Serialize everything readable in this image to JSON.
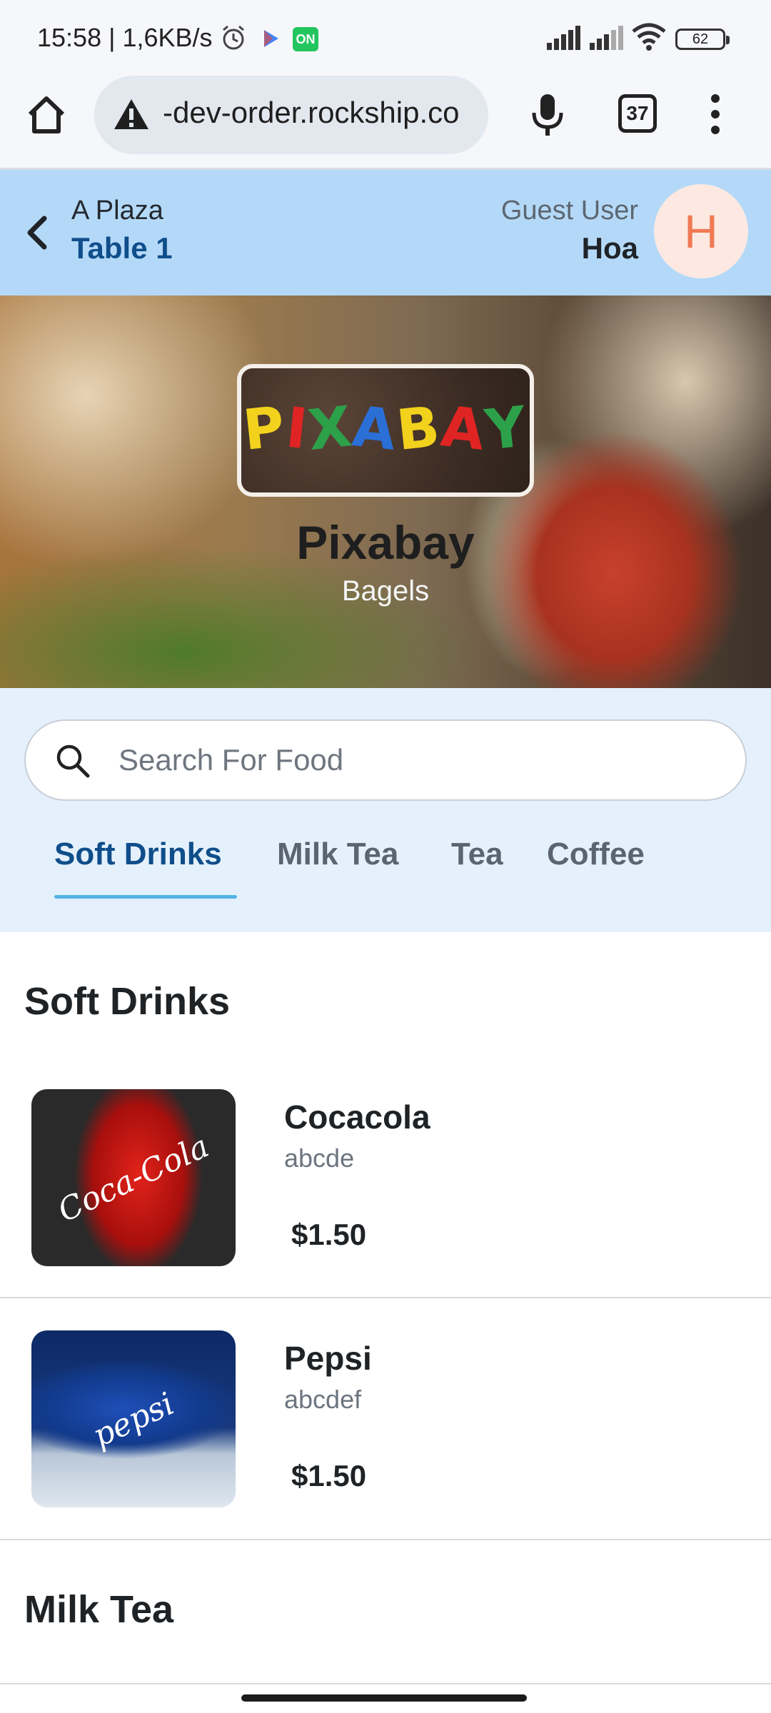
{
  "status_bar": {
    "time_speed": "15:58 | 1,6KB/s",
    "on_badge": "ON",
    "battery": "62"
  },
  "browser": {
    "url": "-dev-order.rockship.co",
    "tab_count": "37"
  },
  "header": {
    "venue": "A Plaza",
    "table": "Table 1",
    "guest_label": "Guest User",
    "guest_name": "Hoa",
    "avatar_initial": "H"
  },
  "hero": {
    "logo_letters": [
      {
        "char": "P",
        "color": "#f2d21c"
      },
      {
        "char": "I",
        "color": "#e02424"
      },
      {
        "char": "X",
        "color": "#2da04a"
      },
      {
        "char": "A",
        "color": "#2a6fd6"
      },
      {
        "char": "B",
        "color": "#f2d21c"
      },
      {
        "char": "A",
        "color": "#e02424"
      },
      {
        "char": "Y",
        "color": "#2da04a"
      }
    ],
    "title": "Pixabay",
    "subtitle": "Bagels"
  },
  "search": {
    "placeholder": "Search For Food",
    "value": ""
  },
  "tabs": [
    {
      "label": "Soft Drinks",
      "active": true
    },
    {
      "label": "Milk Tea",
      "active": false
    },
    {
      "label": "Tea",
      "active": false
    },
    {
      "label": "Coffee",
      "active": false
    }
  ],
  "sections": [
    {
      "title": "Soft Drinks",
      "items": [
        {
          "name": "Cocacola",
          "desc": "abcde",
          "price": "$1.50",
          "image_text": "Coca-Cola"
        },
        {
          "name": "Pepsi",
          "desc": "abcdef",
          "price": "$1.50",
          "image_text": "pepsi"
        }
      ]
    },
    {
      "title": "Milk Tea",
      "items": []
    }
  ],
  "icons": {
    "home": "home-icon",
    "warning": "warning-icon",
    "mic": "mic-icon",
    "menu": "more-vert-icon",
    "back": "chevron-left-icon",
    "search": "search-icon"
  },
  "colors": {
    "header_bg": "#b4d9f8",
    "accent": "#0f4e8a",
    "tab_indicator": "#53b3e6",
    "avatar_text": "#f07a55",
    "avatar_bg": "#fde9e2"
  }
}
